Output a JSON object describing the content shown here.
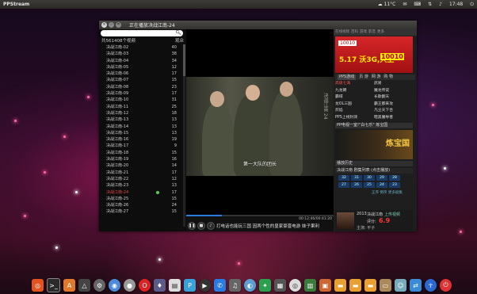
{
  "topbar": {
    "app_title": "PPStream",
    "weather": "☁ 11°C",
    "clock": "17:48"
  },
  "window": {
    "title": "正在播放决战江南-24",
    "controls": [
      "×",
      "–",
      "="
    ]
  },
  "playlist": {
    "header_left": "共561408个视频",
    "header_right": "观众",
    "rows": [
      {
        "name": "决战江南-02",
        "count": "40"
      },
      {
        "name": "决战江南-03",
        "count": "38"
      },
      {
        "name": "决战江南-04",
        "count": "34"
      },
      {
        "name": "决战江南-05",
        "count": "12"
      },
      {
        "name": "决战江南-06",
        "count": "17"
      },
      {
        "name": "决战江南-07",
        "count": "15"
      },
      {
        "name": "决战江南-08",
        "count": "23"
      },
      {
        "name": "决战江南-09",
        "count": "17"
      },
      {
        "name": "决战江南-10",
        "count": "31"
      },
      {
        "name": "决战江南-11",
        "count": "25"
      },
      {
        "name": "决战江南-12",
        "count": "18"
      },
      {
        "name": "决战江南-13",
        "count": "13"
      },
      {
        "name": "决战江南-14",
        "count": "13"
      },
      {
        "name": "决战江南-15",
        "count": "13"
      },
      {
        "name": "决战江南-16",
        "count": "19"
      },
      {
        "name": "决战江南-17",
        "count": "9"
      },
      {
        "name": "决战江南-18",
        "count": "15"
      },
      {
        "name": "决战江南-19",
        "count": "16"
      },
      {
        "name": "决战江南-20",
        "count": "14"
      },
      {
        "name": "决战江南-21",
        "count": "17"
      },
      {
        "name": "决战江南-22",
        "count": "12"
      },
      {
        "name": "决战江南-23",
        "count": "13"
      },
      {
        "name": "决战江南-24",
        "count": "17",
        "active": true
      },
      {
        "name": "决战江南-25",
        "count": "15"
      },
      {
        "name": "决战江南-26",
        "count": "24"
      },
      {
        "name": "决战江南-27",
        "count": "15"
      }
    ]
  },
  "player": {
    "subtitle": "第一大队的团长",
    "watermark": "决战江南 24",
    "time": "00:12:46/00:41:20",
    "ticker": "打电话也能玩三国      因两个性的皇家豪晋电游      妹子果利"
  },
  "side": {
    "tabs": [
      "在线视频",
      "百科",
      "游戏",
      "影音",
      "更多"
    ],
    "ad": {
      "brand": "10010",
      "slogan": "5.17 沃3G,只上",
      "number": "10010",
      "badge": "第2届沃讯"
    },
    "game_tabs": [
      "PPS游戏",
      "页 游",
      "网 游",
      "购 物"
    ],
    "games": [
      [
        "高级七海",
        "武易"
      ],
      [
        "九龙朝",
        "魔龙传说"
      ],
      [
        "霸域",
        "长歌翻天"
      ],
      [
        "龙OL三国",
        "霸王都来攻"
      ],
      [
        "炽焰",
        "凡尘天下合"
      ],
      [
        "PPS上线封测",
        "暗黑魔导者"
      ]
    ],
    "promo_header": "PP电视一室!\"白七乐\" 炼宝国",
    "promo_title": "炼宝国",
    "history_header": "播放历史",
    "history_item": "决战江南 剧集列表 (点击播放)",
    "episodes": [
      "32",
      "31",
      "30",
      "29",
      "28",
      "27",
      "26",
      "25",
      "24",
      "23"
    ],
    "episode_link": "正序  倒序  更多剧集",
    "info": {
      "year": "2013",
      "title": "决战江南",
      "tag": "上传视频",
      "score_label": "评分:",
      "score": "6.9",
      "desc": "主演: 平子"
    }
  }
}
